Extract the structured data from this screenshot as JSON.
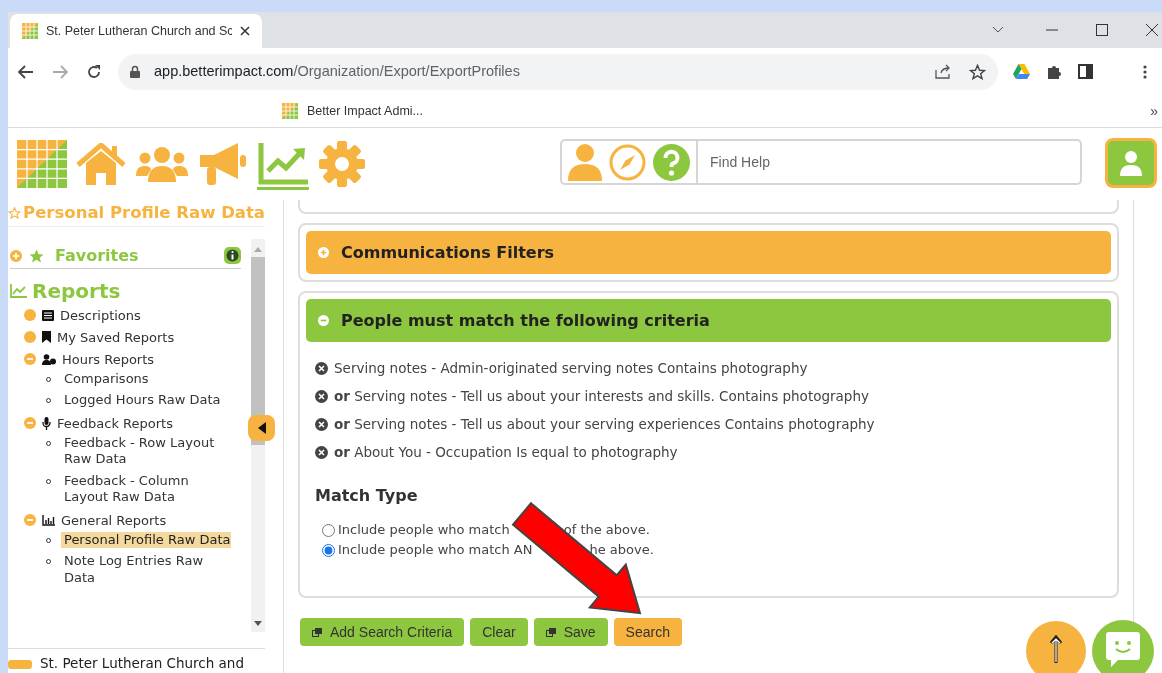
{
  "browser": {
    "tab_title": "St. Peter Lutheran Church and Sc",
    "url_host": "app.betterimpact.com",
    "url_path": "/Organization/Export/ExportProfiles",
    "bookmark": "Better Impact Admi...",
    "bookmarks_more": "»"
  },
  "nav": [
    {
      "kind": "home",
      "selected": false
    },
    {
      "kind": "people",
      "selected": false
    },
    {
      "kind": "megaphone",
      "selected": false
    },
    {
      "kind": "reports",
      "selected": true
    },
    {
      "kind": "settings",
      "selected": false
    }
  ],
  "help": {
    "placeholder": "Find Help"
  },
  "page_title": "Personal Profile Raw Data",
  "sidebar": {
    "favorites": "Favorites",
    "section": "Reports",
    "items": [
      {
        "kind": "link",
        "label": "Descriptions"
      },
      {
        "kind": "link",
        "label": "My Saved Reports"
      },
      {
        "kind": "group",
        "label": "Hours Reports",
        "expanded": true,
        "children": [
          {
            "label": "Comparisons",
            "selected": false
          },
          {
            "label": "Logged Hours Raw Data",
            "selected": false
          }
        ]
      },
      {
        "kind": "group",
        "label": "Feedback Reports",
        "expanded": true,
        "children": [
          {
            "label": "Feedback - Row Layout Raw Data",
            "selected": false
          },
          {
            "label": "Feedback - Column Layout Raw Data",
            "selected": false
          }
        ]
      },
      {
        "kind": "group",
        "label": "General Reports",
        "expanded": true,
        "children": [
          {
            "label": "Personal Profile Raw Data",
            "selected": true
          },
          {
            "label": "Note Log Entries Raw Data",
            "selected": false
          }
        ]
      }
    ],
    "org": "St. Peter Lutheran Church and"
  },
  "panels": [
    {
      "title": "Communications Filters",
      "expanded": false
    },
    {
      "title": "People must match the following criteria",
      "expanded": true
    }
  ],
  "criteria": [
    "Serving notes - Admin-originated serving notes Contains photography",
    "**or** Serving notes - Tell us about your interests and skills. Contains photography",
    "**or** Serving notes - Tell us about your serving experiences Contains photography",
    "**or** About You - Occupation Is equal to photography"
  ],
  "match_type": {
    "title": "Match Type",
    "options": [
      {
        "label_start": "Include people who match",
        "label_end": "of the above.",
        "selected": false
      },
      {
        "label_start": "Include people who match AN",
        "label_end": "he above.",
        "selected": true
      }
    ]
  },
  "buttons": [
    {
      "label": "Add Search Criteria",
      "kind": "green",
      "icon": true
    },
    {
      "label": "Clear",
      "kind": "green",
      "icon": false
    },
    {
      "label": "Save",
      "kind": "green",
      "icon": true
    },
    {
      "label": "Search",
      "kind": "orange",
      "icon": false
    }
  ]
}
